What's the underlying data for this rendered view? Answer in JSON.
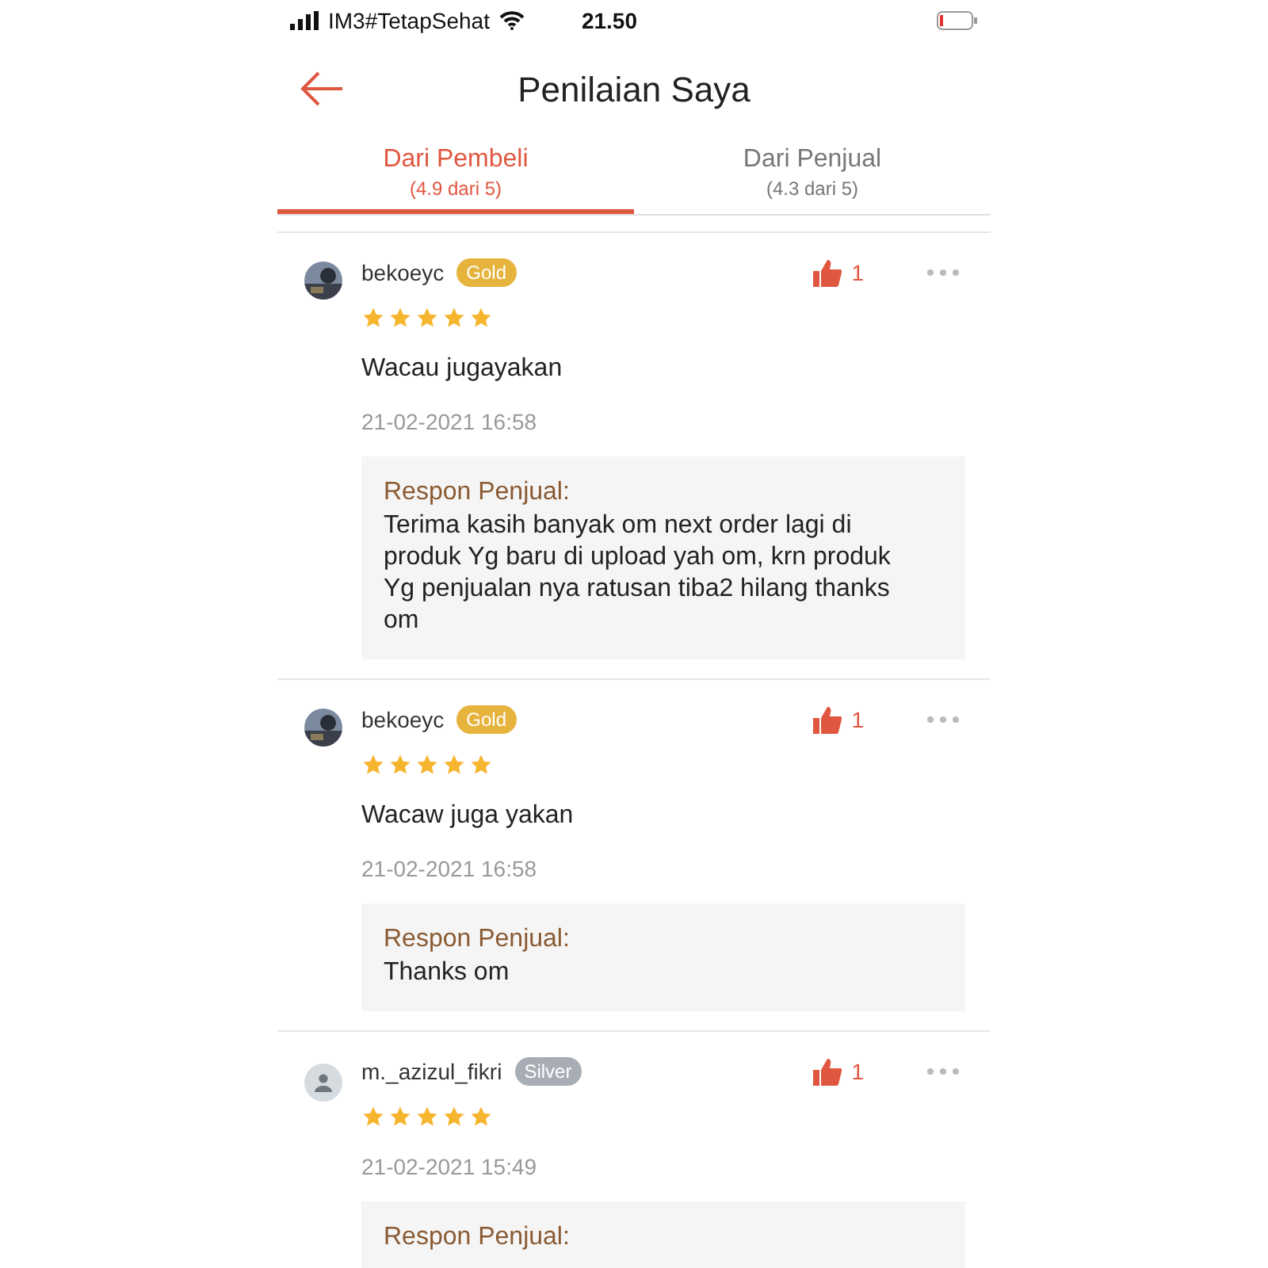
{
  "status_bar": {
    "carrier": "IM3#TetapSehat",
    "time": "21.50"
  },
  "header": {
    "title": "Penilaian Saya"
  },
  "tabs": [
    {
      "label": "Dari Pembeli",
      "sub": "(4.9 dari 5)",
      "selected": true
    },
    {
      "label": "Dari Penjual",
      "sub": "(4.3 dari 5)",
      "selected": false
    }
  ],
  "reviews": [
    {
      "user": "bekoeyc",
      "badge": {
        "label": "Gold",
        "kind": "gold"
      },
      "stars": 5,
      "likes": "1",
      "comment": "Wacau jugayakan",
      "date": "21-02-2021 16:58",
      "response": {
        "title": "Respon Penjual:",
        "text": "Terima kasih banyak om next order lagi di produk Yg baru di upload yah om, krn produk Yg penjualan nya ratusan tiba2 hilang thanks om"
      }
    },
    {
      "user": "bekoeyc",
      "badge": {
        "label": "Gold",
        "kind": "gold"
      },
      "stars": 5,
      "likes": "1",
      "comment": "Wacaw juga yakan",
      "date": "21-02-2021 16:58",
      "response": {
        "title": "Respon Penjual:",
        "text": "Thanks om"
      }
    },
    {
      "avatar": {
        "kind": "icon"
      },
      "user": "m._azizul_fikri",
      "badge": {
        "label": "Silver",
        "kind": "silver"
      },
      "stars": 5,
      "likes": "1",
      "date": "21-02-2021 15:49",
      "response": {
        "title": "Respon Penjual:"
      }
    }
  ]
}
